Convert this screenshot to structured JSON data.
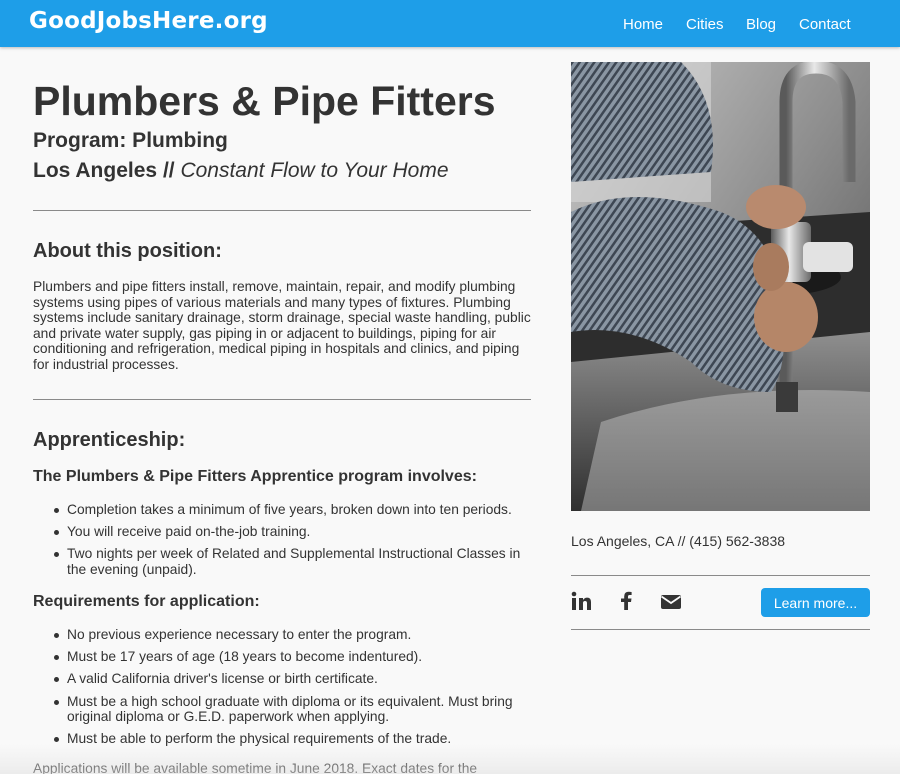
{
  "header": {
    "brand": "GoodJobsHere.org",
    "nav": [
      "Home",
      "Cities",
      "Blog",
      "Contact"
    ]
  },
  "main": {
    "title": "Plumbers & Pipe Fitters",
    "program": "Program: Plumbing",
    "city": "Los Angeles",
    "separator": "//",
    "tagline": "Constant Flow to Your Home",
    "about_heading": "About this position:",
    "about_text": "Plumbers and pipe fitters install, remove, maintain, repair, and modify plumbing systems using pipes of various materials and many types of fixtures. Plumbing systems include sanitary drainage, storm drainage, special waste handling, public and private water supply, gas piping in or adjacent to buildings, piping for air conditioning and refrigeration, medical piping in hospitals and clinics, and piping for industrial processes.",
    "apprenticeship_heading": "Apprenticeship:",
    "involves_heading": "The Plumbers & Pipe Fitters Apprentice program involves:",
    "involves_items": [
      "Completion takes a minimum of five years, broken down into ten periods.",
      "You will receive paid on-the-job training.",
      "Two nights per week of Related and Supplemental Instructional Classes in the evening (unpaid)."
    ],
    "requirements_heading": "Requirements for application:",
    "requirements_items": [
      "No previous experience necessary to enter the program.",
      "Must be 17 years of age (18 years to become indentured).",
      "A valid California driver's license or birth certificate.",
      "Must be a high school graduate with diploma or its equivalent. Must bring original diploma or G.E.D. paperwork when applying.",
      "Must be able to perform the physical requirements of the trade."
    ],
    "applications_text": "Applications will be available sometime in June 2018. Exact dates for the"
  },
  "sidebar": {
    "contact": "Los Angeles, CA // (415) 562-3838",
    "social_icons": [
      "linkedin-icon",
      "facebook-icon",
      "email-icon"
    ],
    "learn_more": "Learn more..."
  },
  "colors": {
    "accent": "#1e9ee8",
    "text": "#333333",
    "background": "#f9f9f9"
  }
}
